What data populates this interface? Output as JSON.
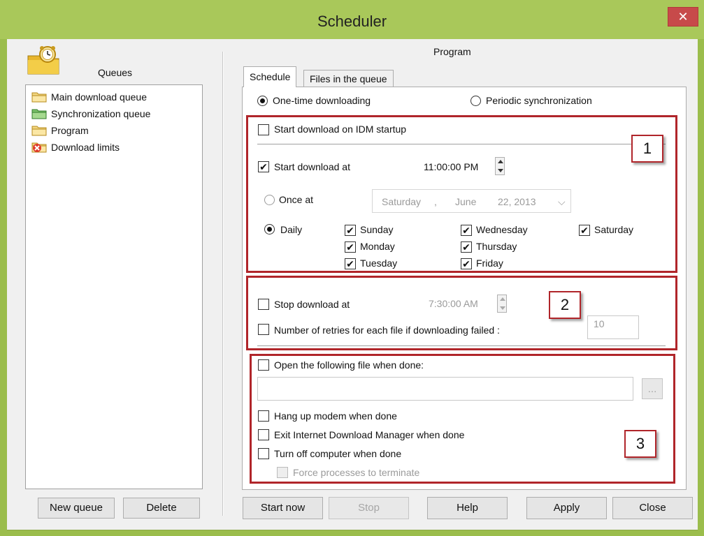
{
  "window": {
    "title": "Scheduler",
    "close_symbol": "✕"
  },
  "left": {
    "queues_label": "Queues",
    "queues": [
      {
        "label": "Main download queue",
        "icon": "folder-icon"
      },
      {
        "label": "Synchronization queue",
        "icon": "sync-folder-icon"
      },
      {
        "label": "Program",
        "icon": "folder-icon"
      },
      {
        "label": "Download limits",
        "icon": "download-limits-icon"
      }
    ],
    "new_queue_label": "New queue",
    "delete_label": "Delete"
  },
  "right": {
    "program_title": "Program",
    "tabs": [
      {
        "label": "Schedule",
        "active": true
      },
      {
        "label": "Files in the queue",
        "active": false
      }
    ],
    "mode": {
      "one_time": "One-time downloading",
      "periodic": "Periodic synchronization",
      "selected": "one_time"
    },
    "start_on_startup": {
      "label": "Start download on IDM startup",
      "checked": false
    },
    "start_at": {
      "label": "Start download at",
      "checked": true,
      "time": "11:00:00 PM"
    },
    "once_at": {
      "label": "Once at",
      "weekday": "Saturday",
      "comma": ",",
      "month": "June",
      "daydate": "22, 2013",
      "dropdown": "⌵"
    },
    "daily": {
      "label": "Daily",
      "selected": true
    },
    "days": [
      {
        "label": "Sunday",
        "checked": true
      },
      {
        "label": "Monday",
        "checked": true
      },
      {
        "label": "Tuesday",
        "checked": true
      },
      {
        "label": "Wednesday",
        "checked": true
      },
      {
        "label": "Thursday",
        "checked": true
      },
      {
        "label": "Friday",
        "checked": true
      },
      {
        "label": "Saturday",
        "checked": true
      }
    ],
    "stop_at": {
      "label": "Stop download at",
      "checked": false,
      "time": "7:30:00 AM"
    },
    "retries": {
      "label": "Number of retries for each file if downloading failed :",
      "checked": false,
      "value": "10"
    },
    "open_file": {
      "label": "Open the following file when done:",
      "checked": false,
      "value": "",
      "browse": "..."
    },
    "hang_up": {
      "label": "Hang up modem when done",
      "checked": false
    },
    "exit_idm": {
      "label": "Exit Internet Download Manager when done",
      "checked": false
    },
    "turn_off": {
      "label": "Turn off computer when done",
      "checked": false
    },
    "force_terminate": {
      "label": "Force processes to terminate",
      "checked": false
    }
  },
  "callouts": [
    "1",
    "2",
    "3"
  ],
  "buttons": {
    "start_now": "Start now",
    "stop": "Stop",
    "help": "Help",
    "apply": "Apply",
    "close": "Close"
  },
  "check_mark": "✔",
  "colors": {
    "title_bar": "#a9c85a",
    "highlight": "#b0252a",
    "close_button": "#c74a4a"
  }
}
